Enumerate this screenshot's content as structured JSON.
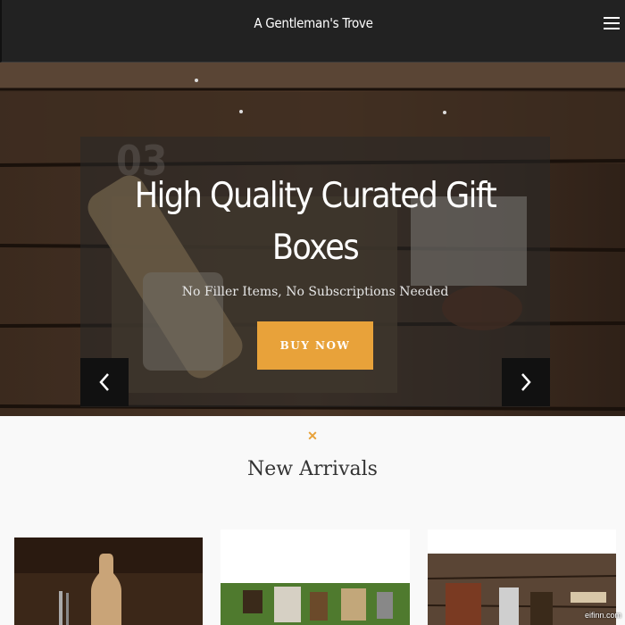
{
  "header": {
    "site_title": "A Gentleman's Trove"
  },
  "hero": {
    "slide_number": "03",
    "title": "High Quality Curated Gift Boxes",
    "subtitle": "No Filler Items, No Subscriptions Needed",
    "cta_label": "BUY NOW"
  },
  "section": {
    "divider": "✕",
    "title": "New Arrivals"
  },
  "products": [
    {
      "image": "bottle-on-wood"
    },
    {
      "image": "golf-accessories-on-grass"
    },
    {
      "image": "leather-kit-on-wood"
    }
  ],
  "watermark": "eifinn.com",
  "colors": {
    "header_bg": "#222222",
    "accent": "#e8a23a",
    "page_bg": "#f9f9f9"
  }
}
